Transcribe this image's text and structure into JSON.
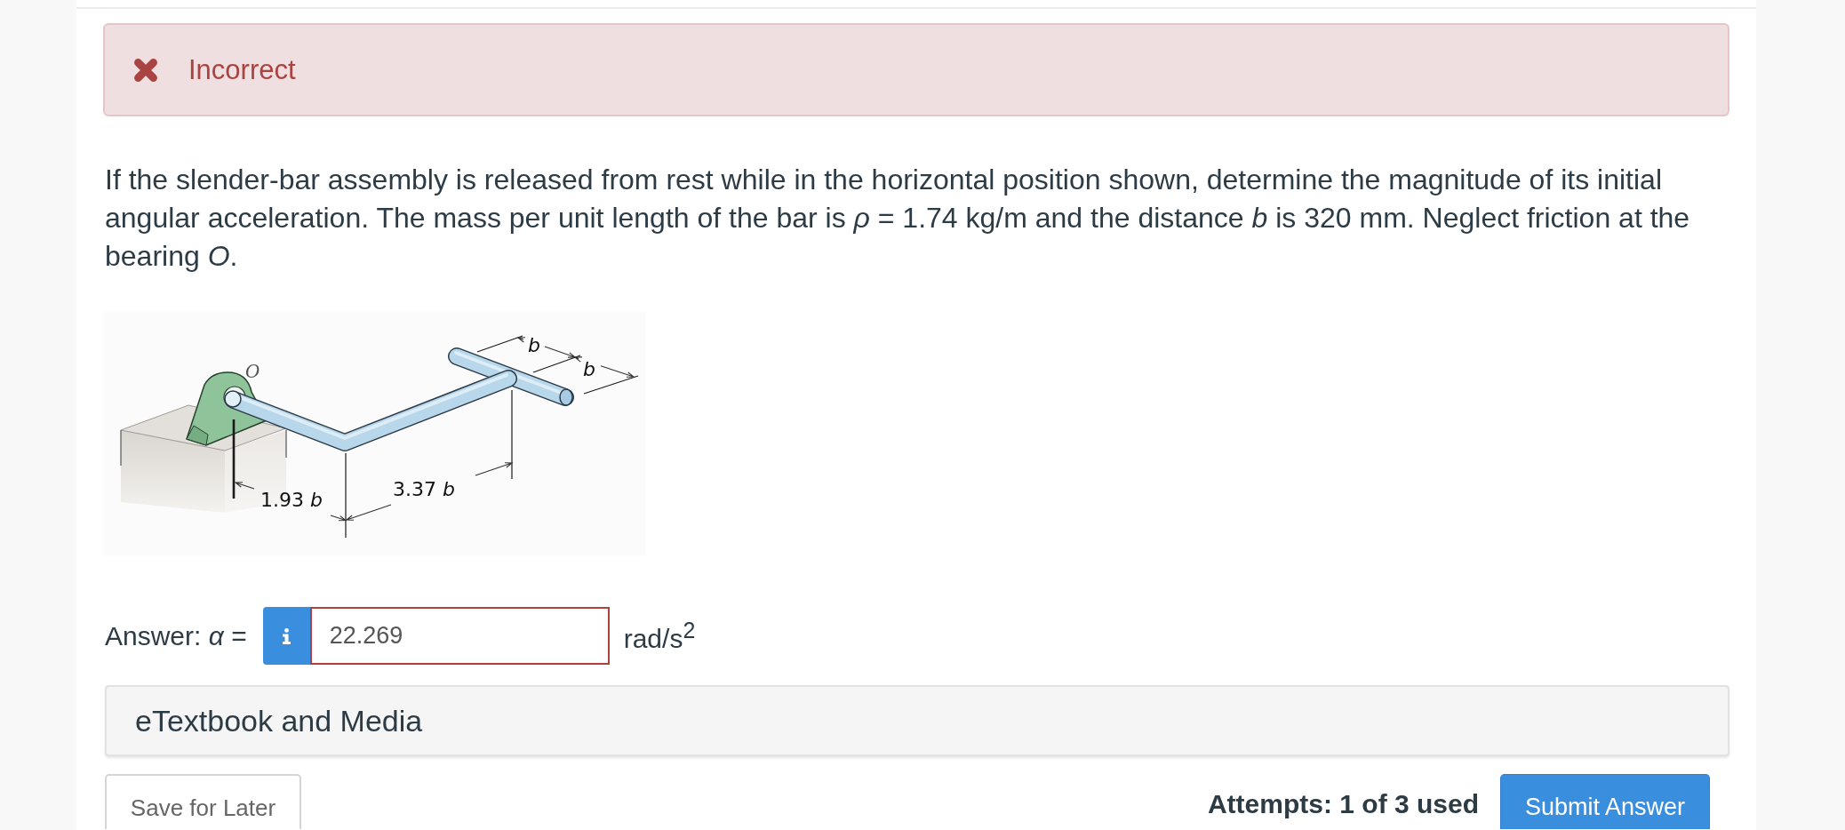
{
  "feedback": {
    "kind": "incorrect",
    "label": "Incorrect"
  },
  "question": {
    "text": "If the slender-bar assembly is released from rest while in the horizontal position shown, determine the magnitude of its initial angular acceleration. The mass per unit length of the bar is *ρ* = 1.74 kg/m and the distance *b* is 320 mm. Neglect friction at the bearing *O*."
  },
  "figure": {
    "labels": [
      {
        "kind": "point",
        "text": "O"
      },
      {
        "kind": "variable",
        "text": "b"
      },
      {
        "kind": "variable",
        "text": "b"
      },
      {
        "kind": "dimension",
        "text": "1.93 *b*"
      },
      {
        "kind": "dimension",
        "text": "3.37 *b*"
      }
    ]
  },
  "answer": {
    "label": "Answer: *α* =",
    "value": "22.269",
    "unit": "rad/s$^{2}$",
    "invalid": true
  },
  "resources_panel": {
    "title": "eTextbook and Media"
  },
  "actions": {
    "save_button": "Save for Later",
    "attempts": "Attempts: 1 of 3 used",
    "submit_button": "Submit Answer"
  }
}
